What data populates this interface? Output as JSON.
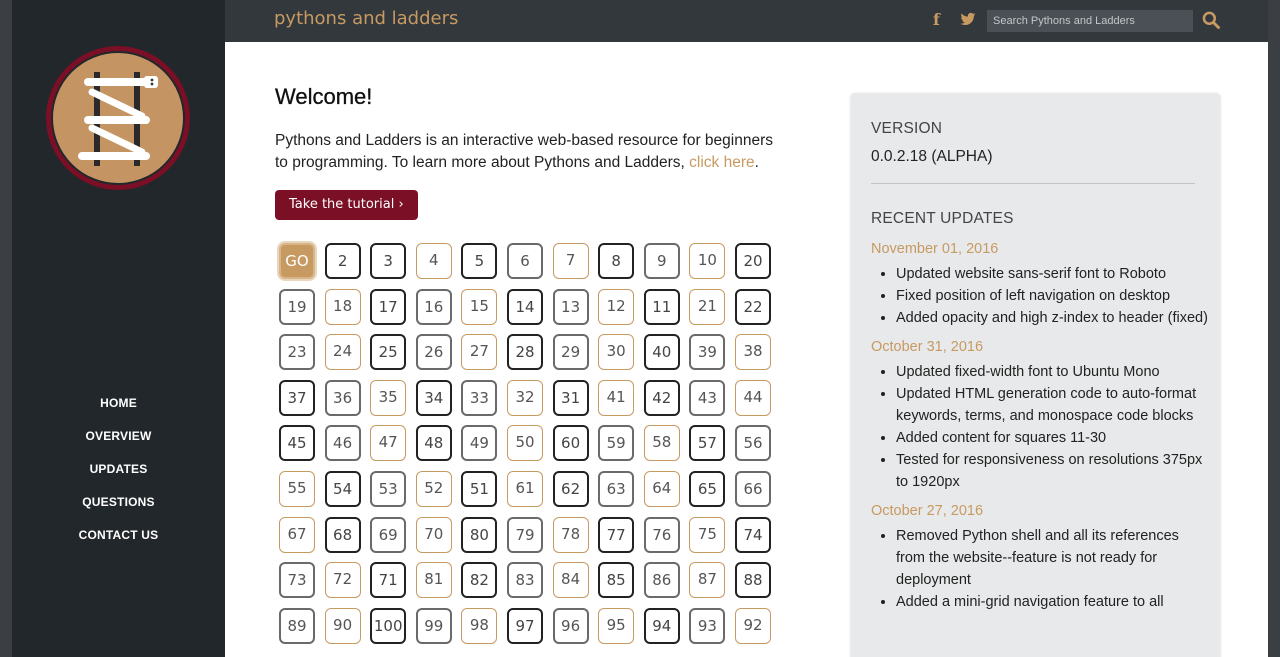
{
  "brand": "pythons and ladders",
  "search": {
    "placeholder": "Search Pythons and Ladders"
  },
  "nav": [
    "HOME",
    "OVERVIEW",
    "UPDATES",
    "QUESTIONS",
    "CONTACT US"
  ],
  "main": {
    "title": "Welcome!",
    "intro": "Pythons and Ladders is an interactive web-based resource for beginners to programming. To learn more about Pythons and Ladders, ",
    "intro_link": "click here",
    "intro_end": ".",
    "tutorial_button": "Take the tutorial ›"
  },
  "grid": {
    "rows": [
      [
        "GO",
        "2",
        "3",
        "4",
        "5",
        "6",
        "7",
        "8",
        "9",
        "10",
        "20"
      ],
      [
        "19",
        "18",
        "17",
        "16",
        "15",
        "14",
        "13",
        "12",
        "11",
        "21",
        "22"
      ],
      [
        "23",
        "24",
        "25",
        "26",
        "27",
        "28",
        "29",
        "30",
        "40",
        "39",
        "38"
      ],
      [
        "37",
        "36",
        "35",
        "34",
        "33",
        "32",
        "31",
        "41",
        "42",
        "43",
        "44"
      ],
      [
        "45",
        "46",
        "47",
        "48",
        "49",
        "50",
        "60",
        "59",
        "58",
        "57",
        "56"
      ],
      [
        "55",
        "54",
        "53",
        "52",
        "51",
        "61",
        "62",
        "63",
        "64",
        "65",
        "66"
      ],
      [
        "67",
        "68",
        "69",
        "70",
        "80",
        "79",
        "78",
        "77",
        "76",
        "75",
        "74"
      ],
      [
        "73",
        "72",
        "71",
        "81",
        "82",
        "83",
        "84",
        "85",
        "86",
        "87",
        "88"
      ],
      [
        "89",
        "90",
        "100",
        "99",
        "98",
        "97",
        "96",
        "95",
        "94",
        "93",
        "92"
      ]
    ],
    "styles": [
      [
        "go",
        "dark",
        "dark",
        "gold",
        "dark",
        "grey",
        "gold",
        "dark",
        "grey",
        "gold",
        "dark"
      ],
      [
        "grey",
        "gold",
        "dark",
        "grey",
        "gold",
        "dark",
        "grey",
        "gold",
        "dark",
        "gold",
        "dark"
      ],
      [
        "grey",
        "gold",
        "dark",
        "grey",
        "gold",
        "dark",
        "grey",
        "gold",
        "dark",
        "grey",
        "gold"
      ],
      [
        "dark",
        "grey",
        "gold",
        "dark",
        "grey",
        "gold",
        "dark",
        "gold",
        "dark",
        "grey",
        "gold"
      ],
      [
        "dark",
        "grey",
        "gold",
        "dark",
        "grey",
        "gold",
        "dark",
        "grey",
        "gold",
        "dark",
        "grey"
      ],
      [
        "gold",
        "dark",
        "grey",
        "gold",
        "dark",
        "gold",
        "dark",
        "grey",
        "gold",
        "dark",
        "grey"
      ],
      [
        "gold",
        "dark",
        "grey",
        "gold",
        "dark",
        "grey",
        "gold",
        "dark",
        "grey",
        "gold",
        "dark"
      ],
      [
        "grey",
        "gold",
        "dark",
        "gold",
        "dark",
        "grey",
        "gold",
        "dark",
        "grey",
        "gold",
        "dark"
      ],
      [
        "grey",
        "gold",
        "dark",
        "grey",
        "gold",
        "dark",
        "grey",
        "gold",
        "dark",
        "grey",
        "gold"
      ]
    ]
  },
  "panel": {
    "version_label": "VERSION",
    "version_value": "0.0.2.18 (ALPHA)",
    "recent_label": "RECENT UPDATES",
    "updates": [
      {
        "date": "November 01, 2016",
        "items": [
          "Updated website sans-serif font to Roboto",
          "Fixed position of left navigation on desktop",
          "Added opacity and high z-index to header (fixed)"
        ]
      },
      {
        "date": "October 31, 2016",
        "items": [
          "Updated fixed-width font to Ubuntu Mono",
          "Updated HTML generation code to auto-format keywords, terms, and monospace code blocks",
          "Added content for squares 11-30",
          "Tested for responsiveness on resolutions 375px to 1920px"
        ]
      },
      {
        "date": "October 27, 2016",
        "items": [
          "Removed Python shell and all its references from the website--feature is not ready for deployment",
          "Added a mini-grid navigation feature to all"
        ]
      }
    ]
  },
  "colors": {
    "accent": "#c79a62",
    "button": "#7a0f25",
    "sidebar": "#22272b",
    "topbar": "#33383d"
  }
}
